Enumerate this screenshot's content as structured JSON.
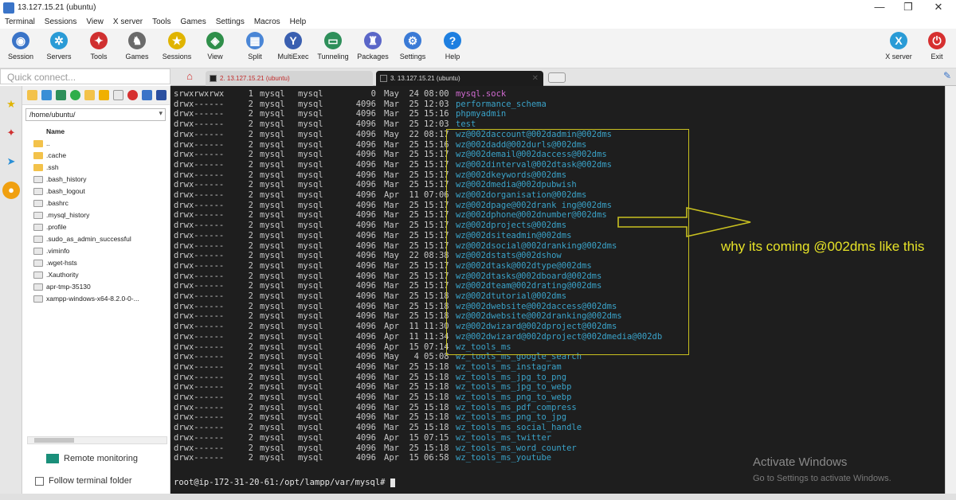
{
  "window": {
    "title": "13.127.15.21 (ubuntu)",
    "controls": {
      "minimize": "—",
      "maximize": "❐",
      "close": "✕"
    }
  },
  "menu": [
    "Terminal",
    "Sessions",
    "View",
    "X server",
    "Tools",
    "Games",
    "Settings",
    "Macros",
    "Help"
  ],
  "toolbar": [
    {
      "label": "Session",
      "icon": "session-icon",
      "color": "#3a74c8",
      "glyph": "◉"
    },
    {
      "label": "Servers",
      "icon": "servers-icon",
      "color": "#2a9bd6",
      "glyph": "✲"
    },
    {
      "label": "Tools",
      "icon": "tools-icon",
      "color": "#d03030",
      "glyph": "✦"
    },
    {
      "label": "Games",
      "icon": "games-icon",
      "color": "#6a6a6a",
      "glyph": "♞"
    },
    {
      "label": "Sessions",
      "icon": "sessions-star-icon",
      "color": "#e0b400",
      "glyph": "★"
    },
    {
      "label": "View",
      "icon": "view-icon",
      "color": "#2f8f4a",
      "glyph": "◈"
    },
    {
      "label": "Split",
      "icon": "split-icon",
      "color": "#4a86d6",
      "glyph": "▦"
    },
    {
      "label": "MultiExec",
      "icon": "multiexec-icon",
      "color": "#3a5fb0",
      "glyph": "Y"
    },
    {
      "label": "Tunneling",
      "icon": "tunneling-icon",
      "color": "#2e8f5a",
      "glyph": "▭"
    },
    {
      "label": "Packages",
      "icon": "packages-icon",
      "color": "#5a66c8",
      "glyph": "♜"
    },
    {
      "label": "Settings",
      "icon": "settings-icon",
      "color": "#3a7ad6",
      "glyph": "⚙"
    },
    {
      "label": "Help",
      "icon": "help-icon",
      "color": "#1e7fe0",
      "glyph": "?"
    }
  ],
  "toolbar_right": [
    {
      "label": "X server",
      "icon": "xserver-icon",
      "color": "#2a9bd6",
      "glyph": "X"
    },
    {
      "label": "Exit",
      "icon": "exit-icon",
      "color": "#d63030",
      "glyph": "⏻"
    }
  ],
  "quick_connect": {
    "placeholder": "Quick connect..."
  },
  "tabs": [
    {
      "label": "2. 13.127.15.21 (ubuntu)",
      "state": "inactive"
    },
    {
      "label": "3. 13.127.15.21 (ubuntu)",
      "state": "active"
    }
  ],
  "sidebar": {
    "path": "/home/ubuntu/",
    "header": "Name",
    "files": [
      {
        "name": "..",
        "type": "folder"
      },
      {
        "name": ".cache",
        "type": "folder"
      },
      {
        "name": ".ssh",
        "type": "folder"
      },
      {
        "name": ".bash_history",
        "type": "file"
      },
      {
        "name": ".bash_logout",
        "type": "file"
      },
      {
        "name": ".bashrc",
        "type": "file"
      },
      {
        "name": ".mysql_history",
        "type": "file"
      },
      {
        "name": ".profile",
        "type": "file"
      },
      {
        "name": ".sudo_as_admin_successful",
        "type": "file"
      },
      {
        "name": ".viminfo",
        "type": "file"
      },
      {
        "name": ".wget-hsts",
        "type": "file"
      },
      {
        "name": ".Xauthority",
        "type": "file"
      },
      {
        "name": "apr-tmp-35130",
        "type": "file"
      },
      {
        "name": "xampp-windows-x64-8.2.0-0-...",
        "type": "file"
      }
    ],
    "remote_monitoring": "Remote monitoring",
    "follow_folder": "Follow terminal folder"
  },
  "terminal": {
    "rows": [
      {
        "perm": "srwxrwxrwx",
        "links": "1",
        "user": "mysql",
        "group": "mysql",
        "size": "0",
        "month": "May",
        "day": "24",
        "time": "08:00",
        "name": "mysql.sock",
        "color": "pink"
      },
      {
        "perm": "drwx------",
        "links": "2",
        "user": "mysql",
        "group": "mysql",
        "size": "4096",
        "month": "Mar",
        "day": "25",
        "time": "12:03",
        "name": "performance_schema",
        "color": "blue"
      },
      {
        "perm": "drwx------",
        "links": "2",
        "user": "mysql",
        "group": "mysql",
        "size": "4096",
        "month": "Mar",
        "day": "25",
        "time": "15:16",
        "name": "phpmyadmin",
        "color": "blue"
      },
      {
        "perm": "drwx------",
        "links": "2",
        "user": "mysql",
        "group": "mysql",
        "size": "4096",
        "month": "Mar",
        "day": "25",
        "time": "12:03",
        "name": "test",
        "color": "blue"
      },
      {
        "perm": "drwx------",
        "links": "2",
        "user": "mysql",
        "group": "mysql",
        "size": "4096",
        "month": "May",
        "day": "22",
        "time": "08:17",
        "name": "wz@002daccount@002dadmin@002dms",
        "color": "blue"
      },
      {
        "perm": "drwx------",
        "links": "2",
        "user": "mysql",
        "group": "mysql",
        "size": "4096",
        "month": "Mar",
        "day": "25",
        "time": "15:16",
        "name": "wz@002dadd@002durls@002dms",
        "color": "blue"
      },
      {
        "perm": "drwx------",
        "links": "2",
        "user": "mysql",
        "group": "mysql",
        "size": "4096",
        "month": "Mar",
        "day": "25",
        "time": "15:17",
        "name": "wz@002demail@002daccess@002dms",
        "color": "blue"
      },
      {
        "perm": "drwx------",
        "links": "2",
        "user": "mysql",
        "group": "mysql",
        "size": "4096",
        "month": "Mar",
        "day": "25",
        "time": "15:17",
        "name": "wz@002dinterval@002dtask@002dms",
        "color": "blue"
      },
      {
        "perm": "drwx------",
        "links": "2",
        "user": "mysql",
        "group": "mysql",
        "size": "4096",
        "month": "Mar",
        "day": "25",
        "time": "15:17",
        "name": "wz@002dkeywords@002dms",
        "color": "blue"
      },
      {
        "perm": "drwx------",
        "links": "2",
        "user": "mysql",
        "group": "mysql",
        "size": "4096",
        "month": "Mar",
        "day": "25",
        "time": "15:17",
        "name": "wz@002dmedia@002dpubwish",
        "color": "blue"
      },
      {
        "perm": "drwx------",
        "links": "2",
        "user": "mysql",
        "group": "mysql",
        "size": "4096",
        "month": "Apr",
        "day": "11",
        "time": "07:06",
        "name": "wz@002dorganisation@002dms",
        "color": "blue"
      },
      {
        "perm": "drwx------",
        "links": "2",
        "user": "mysql",
        "group": "mysql",
        "size": "4096",
        "month": "Mar",
        "day": "25",
        "time": "15:17",
        "name": "wz@002dpage@002drank ing@002dms",
        "color": "blue"
      },
      {
        "perm": "drwx------",
        "links": "2",
        "user": "mysql",
        "group": "mysql",
        "size": "4096",
        "month": "Mar",
        "day": "25",
        "time": "15:17",
        "name": "wz@002dphone@002dnumber@002dms",
        "color": "blue"
      },
      {
        "perm": "drwx------",
        "links": "2",
        "user": "mysql",
        "group": "mysql",
        "size": "4096",
        "month": "Mar",
        "day": "25",
        "time": "15:17",
        "name": "wz@002dprojects@002dms",
        "color": "blue"
      },
      {
        "perm": "drwx------",
        "links": "2",
        "user": "mysql",
        "group": "mysql",
        "size": "4096",
        "month": "Mar",
        "day": "25",
        "time": "15:17",
        "name": "wz@002dsiteadmin@002dms",
        "color": "blue"
      },
      {
        "perm": "drwx------",
        "links": "2",
        "user": "mysql",
        "group": "mysql",
        "size": "4096",
        "month": "Mar",
        "day": "25",
        "time": "15:17",
        "name": "wz@002dsocial@002dranking@002dms",
        "color": "blue"
      },
      {
        "perm": "drwx------",
        "links": "2",
        "user": "mysql",
        "group": "mysql",
        "size": "4096",
        "month": "May",
        "day": "22",
        "time": "08:38",
        "name": "wz@002dstats@002dshow",
        "color": "blue"
      },
      {
        "perm": "drwx------",
        "links": "2",
        "user": "mysql",
        "group": "mysql",
        "size": "4096",
        "month": "Mar",
        "day": "25",
        "time": "15:17",
        "name": "wz@002dtask@002dtype@002dms",
        "color": "blue"
      },
      {
        "perm": "drwx------",
        "links": "2",
        "user": "mysql",
        "group": "mysql",
        "size": "4096",
        "month": "Mar",
        "day": "25",
        "time": "15:17",
        "name": "wz@002dtasks@002dboard@002dms",
        "color": "blue"
      },
      {
        "perm": "drwx------",
        "links": "2",
        "user": "mysql",
        "group": "mysql",
        "size": "4096",
        "month": "Mar",
        "day": "25",
        "time": "15:17",
        "name": "wz@002dteam@002drating@002dms",
        "color": "blue"
      },
      {
        "perm": "drwx------",
        "links": "2",
        "user": "mysql",
        "group": "mysql",
        "size": "4096",
        "month": "Mar",
        "day": "25",
        "time": "15:18",
        "name": "wz@002dtutorial@002dms",
        "color": "blue"
      },
      {
        "perm": "drwx------",
        "links": "2",
        "user": "mysql",
        "group": "mysql",
        "size": "4096",
        "month": "Mar",
        "day": "25",
        "time": "15:18",
        "name": "wz@002dwebsite@002daccess@002dms",
        "color": "blue"
      },
      {
        "perm": "drwx------",
        "links": "2",
        "user": "mysql",
        "group": "mysql",
        "size": "4096",
        "month": "Mar",
        "day": "25",
        "time": "15:18",
        "name": "wz@002dwebsite@002dranking@002dms",
        "color": "blue"
      },
      {
        "perm": "drwx------",
        "links": "2",
        "user": "mysql",
        "group": "mysql",
        "size": "4096",
        "month": "Apr",
        "day": "11",
        "time": "11:30",
        "name": "wz@002dwizard@002dproject@002dms",
        "color": "blue"
      },
      {
        "perm": "drwx------",
        "links": "2",
        "user": "mysql",
        "group": "mysql",
        "size": "4096",
        "month": "Apr",
        "day": "11",
        "time": "11:34",
        "name": "wz@002dwizard@002dproject@002dmedia@002db",
        "color": "blue"
      },
      {
        "perm": "drwx------",
        "links": "2",
        "user": "mysql",
        "group": "mysql",
        "size": "4096",
        "month": "Apr",
        "day": "15",
        "time": "07:14",
        "name": "wz_tools_ms",
        "color": "blue"
      },
      {
        "perm": "drwx------",
        "links": "2",
        "user": "mysql",
        "group": "mysql",
        "size": "4096",
        "month": "May",
        "day": "4",
        "time": "05:08",
        "name": "wz_tools_ms_google_search",
        "color": "blue"
      },
      {
        "perm": "drwx------",
        "links": "2",
        "user": "mysql",
        "group": "mysql",
        "size": "4096",
        "month": "Mar",
        "day": "25",
        "time": "15:18",
        "name": "wz_tools_ms_instagram",
        "color": "blue"
      },
      {
        "perm": "drwx------",
        "links": "2",
        "user": "mysql",
        "group": "mysql",
        "size": "4096",
        "month": "Mar",
        "day": "25",
        "time": "15:18",
        "name": "wz_tools_ms_jpg_to_png",
        "color": "blue"
      },
      {
        "perm": "drwx------",
        "links": "2",
        "user": "mysql",
        "group": "mysql",
        "size": "4096",
        "month": "Mar",
        "day": "25",
        "time": "15:18",
        "name": "wz_tools_ms_jpg_to_webp",
        "color": "blue"
      },
      {
        "perm": "drwx------",
        "links": "2",
        "user": "mysql",
        "group": "mysql",
        "size": "4096",
        "month": "Mar",
        "day": "25",
        "time": "15:18",
        "name": "wz_tools_ms_png_to_webp",
        "color": "blue"
      },
      {
        "perm": "drwx------",
        "links": "2",
        "user": "mysql",
        "group": "mysql",
        "size": "4096",
        "month": "Mar",
        "day": "25",
        "time": "15:18",
        "name": "wz_tools_ms_pdf_compress",
        "color": "blue"
      },
      {
        "perm": "drwx------",
        "links": "2",
        "user": "mysql",
        "group": "mysql",
        "size": "4096",
        "month": "Mar",
        "day": "25",
        "time": "15:18",
        "name": "wz_tools_ms_png_to_jpg",
        "color": "blue"
      },
      {
        "perm": "drwx------",
        "links": "2",
        "user": "mysql",
        "group": "mysql",
        "size": "4096",
        "month": "Mar",
        "day": "25",
        "time": "15:18",
        "name": "wz_tools_ms_social_handle",
        "color": "blue"
      },
      {
        "perm": "drwx------",
        "links": "2",
        "user": "mysql",
        "group": "mysql",
        "size": "4096",
        "month": "Apr",
        "day": "15",
        "time": "07:15",
        "name": "wz_tools_ms_twitter",
        "color": "blue"
      },
      {
        "perm": "drwx------",
        "links": "2",
        "user": "mysql",
        "group": "mysql",
        "size": "4096",
        "month": "Mar",
        "day": "25",
        "time": "15:18",
        "name": "wz_tools_ms_word_counter",
        "color": "blue"
      },
      {
        "perm": "drwx------",
        "links": "2",
        "user": "mysql",
        "group": "mysql",
        "size": "4096",
        "month": "Apr",
        "day": "15",
        "time": "06:58",
        "name": "wz_tools_ms_youtube",
        "color": "blue"
      }
    ],
    "prompt": "root@ip-172-31-20-61:/opt/lampp/var/mysql# "
  },
  "annotation": {
    "text": "why its coming @002dms like this",
    "color": "#e6e228"
  },
  "watermark": {
    "line1": "Activate Windows",
    "line2": "Go to Settings to activate Windows."
  }
}
